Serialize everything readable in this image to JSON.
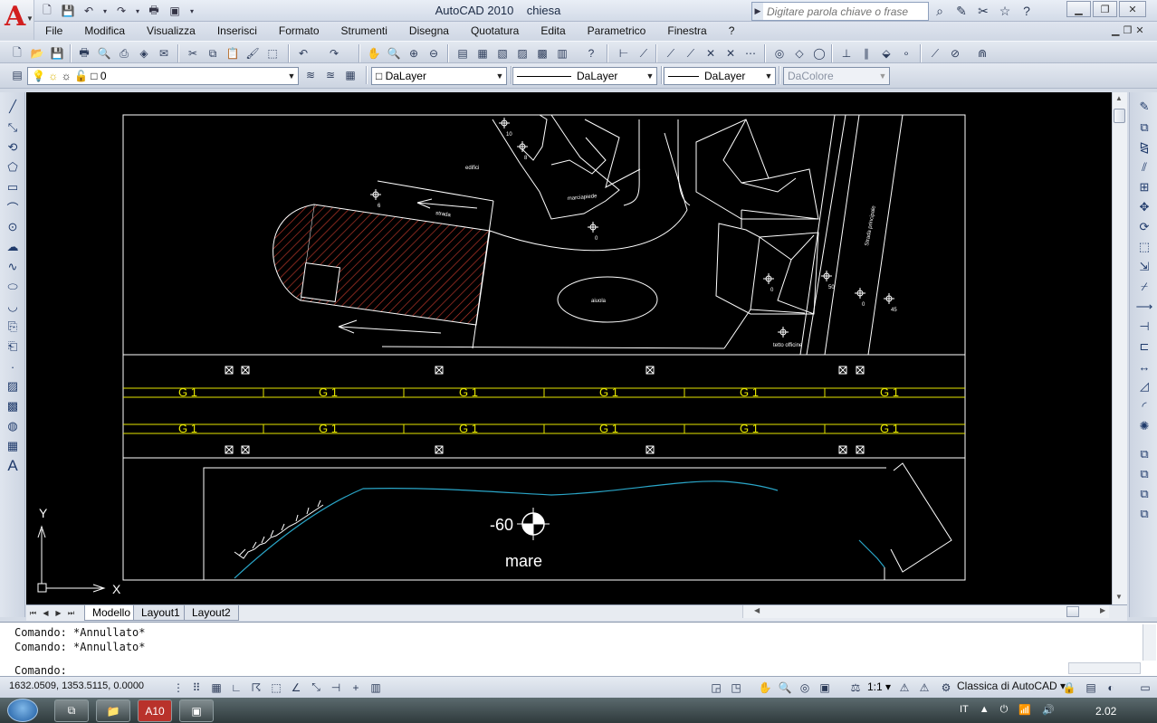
{
  "window": {
    "title": "AutoCAD 2010",
    "document": "chiesa",
    "search_placeholder": "Digitare parola chiave o frase",
    "controls": [
      "minimize",
      "maximize",
      "close"
    ]
  },
  "app_logo": "A",
  "menu": [
    "File",
    "Modifica",
    "Visualizza",
    "Inserisci",
    "Formato",
    "Strumenti",
    "Disegna",
    "Quotatura",
    "Edita",
    "Parametrico",
    "Finestra",
    "?"
  ],
  "layers_toolbar": {
    "current_layer": "0",
    "color": "DaLayer",
    "linetype": "DaLayer",
    "lineweight": "DaLayer",
    "plotstyle": "DaColore"
  },
  "drawing": {
    "labels": {
      "edifici": "edifici",
      "strada": "strada",
      "marciapiede": "marciapiede",
      "aiuola": "aiuola",
      "tetto_officine": "tetto officine",
      "strada_principale": "Strada principale",
      "mare": "mare",
      "depth": "-60",
      "g1": "G 1",
      "axis_x": "X",
      "axis_y": "Y"
    },
    "elevations": [
      "10",
      "8",
      "6",
      "0",
      "50",
      "0",
      "0",
      "45"
    ],
    "g1_count_per_row": 6
  },
  "layout_tabs": [
    "Modello",
    "Layout1",
    "Layout2"
  ],
  "active_tab": "Modello",
  "command_history": [
    "Comando: *Annullato*",
    "Comando: *Annullato*"
  ],
  "command_prompt": "Comando:",
  "status": {
    "coords": "1632.0509, 1353.5115, 0.0000",
    "annotation_scale": "1:1",
    "workspace": "Classica di AutoCAD"
  },
  "taskbar": {
    "language": "IT",
    "time": "2.02",
    "app_badge": "A10"
  },
  "colors": {
    "hatch": "#c0392b",
    "g1": "#e6e600",
    "coast": "#2aa6c8",
    "canvas": "#000000",
    "lines": "#ffffff"
  }
}
